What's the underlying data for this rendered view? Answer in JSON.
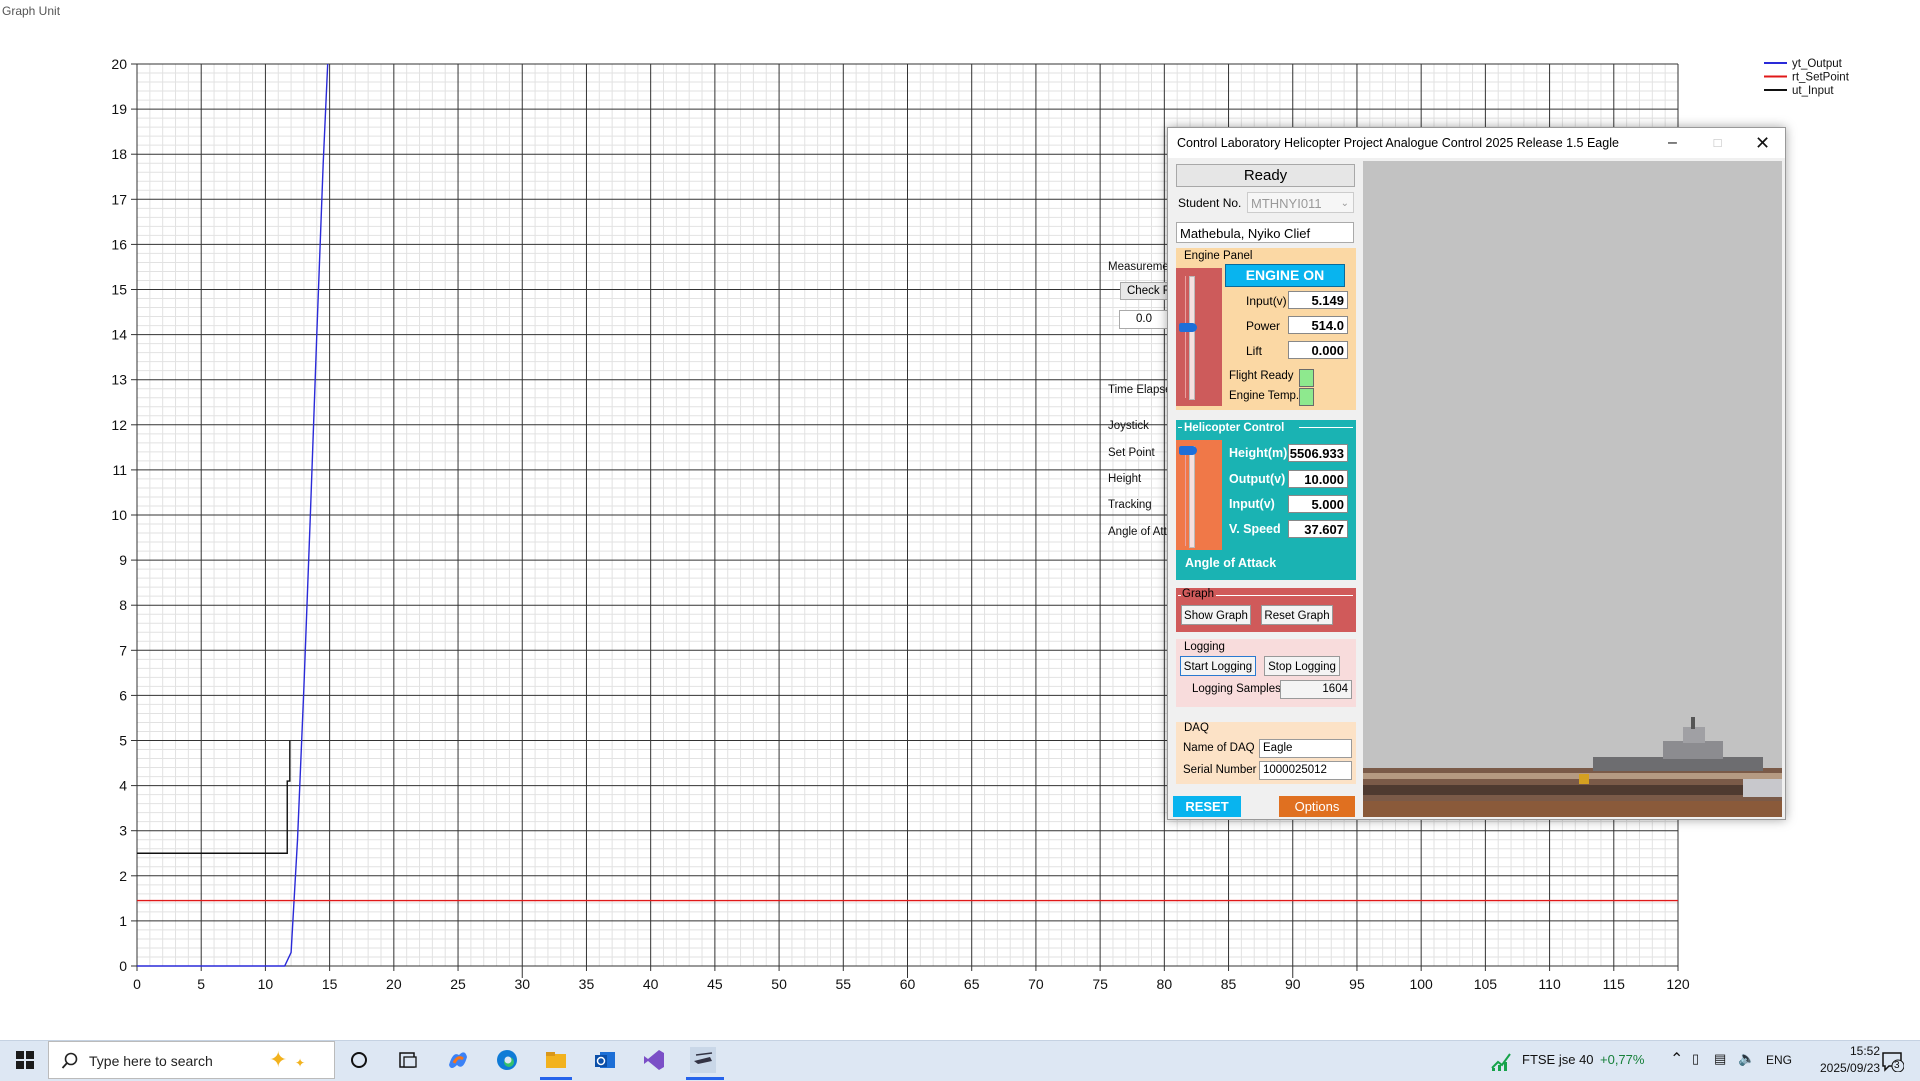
{
  "graph_window": {
    "title": "Graph Unit"
  },
  "chart_data": {
    "type": "line",
    "x_ticks": [
      0,
      5,
      10,
      15,
      20,
      25,
      30,
      35,
      40,
      45,
      50,
      55,
      60,
      65,
      70,
      75,
      80,
      85,
      90,
      95,
      100,
      105,
      110,
      115,
      120
    ],
    "y_ticks": [
      0,
      1,
      2,
      3,
      4,
      5,
      6,
      7,
      8,
      9,
      10,
      11,
      12,
      13,
      14,
      15,
      16,
      17,
      18,
      19,
      20
    ],
    "xlim": [
      0,
      120
    ],
    "ylim": [
      0,
      20
    ],
    "grid": true,
    "legend_position": "top-right",
    "series": [
      {
        "name": "yt_Output",
        "color": "#2a2ad8",
        "x": [
          0,
          11.5,
          12,
          12.5,
          13,
          13.5,
          14,
          14.5,
          14.85
        ],
        "y": [
          0,
          0,
          0.3,
          2.8,
          6.2,
          10,
          14,
          17.8,
          20
        ]
      },
      {
        "name": "rt_SetPoint",
        "color": "#e01818",
        "x": [
          0,
          120
        ],
        "y": [
          1.45,
          1.45
        ]
      },
      {
        "name": "ut_Input",
        "color": "#111111",
        "x": [
          0,
          11.7,
          11.7,
          11.9,
          11.9
        ],
        "y": [
          2.5,
          2.5,
          4.1,
          4.1,
          5
        ]
      }
    ]
  },
  "background_panel": {
    "measurement_label": "Measuremen",
    "check_button": "Check F",
    "value": "0.0",
    "time_elapsed": "Time Elapse",
    "labels": [
      "Joystick",
      "Set Point",
      "Height",
      "Tracking",
      "Angle of Atta"
    ]
  },
  "app": {
    "title": "Control Laboratory Helicopter Project Analogue Control 2025 Release 1.5 Eagle",
    "status": "Ready",
    "student_label": "Student No.",
    "student_no": "MTHNYI011",
    "student_name": "Mathebula, Nyiko Clief",
    "engine": {
      "title": "Engine Panel",
      "button": "ENGINE ON",
      "input_label": "Input(v)",
      "input": "5.149",
      "power_label": "Power",
      "power": "514.0",
      "lift_label": "Lift",
      "lift": "0.000",
      "flight_ready_label": "Flight Ready",
      "engine_temp_label": "Engine Temp.",
      "slider_level": 0.58
    },
    "heli": {
      "title": "Helicopter Control",
      "height_label": "Height(m)",
      "height": "5506.933",
      "output_label": "Output(v)",
      "output": "10.000",
      "input_label": "Input(v)",
      "input": "5.000",
      "vspeed_label": "V. Speed",
      "vspeed": "37.607",
      "angle_label": "Angle of Attack",
      "slider_level": 1.0
    },
    "graph": {
      "title": "Graph",
      "show": "Show Graph",
      "reset": "Reset Graph"
    },
    "logging": {
      "title": "Logging",
      "start": "Start Logging",
      "stop": "Stop Logging",
      "samples_label": "Logging Samples",
      "samples": "1604"
    },
    "daq": {
      "title": "DAQ",
      "name_label": "Name of DAQ",
      "name": "Eagle",
      "serial_label": "Serial Number",
      "serial": "1000025012"
    },
    "reset": "RESET",
    "options": "Options"
  },
  "taskbar": {
    "search_placeholder": "Type here to search",
    "stock_name": "FTSE jse 40",
    "stock_change": "+0,77%",
    "language": "ENG",
    "time": "15:52",
    "date": "2025/09/23",
    "notification_count": "3"
  }
}
